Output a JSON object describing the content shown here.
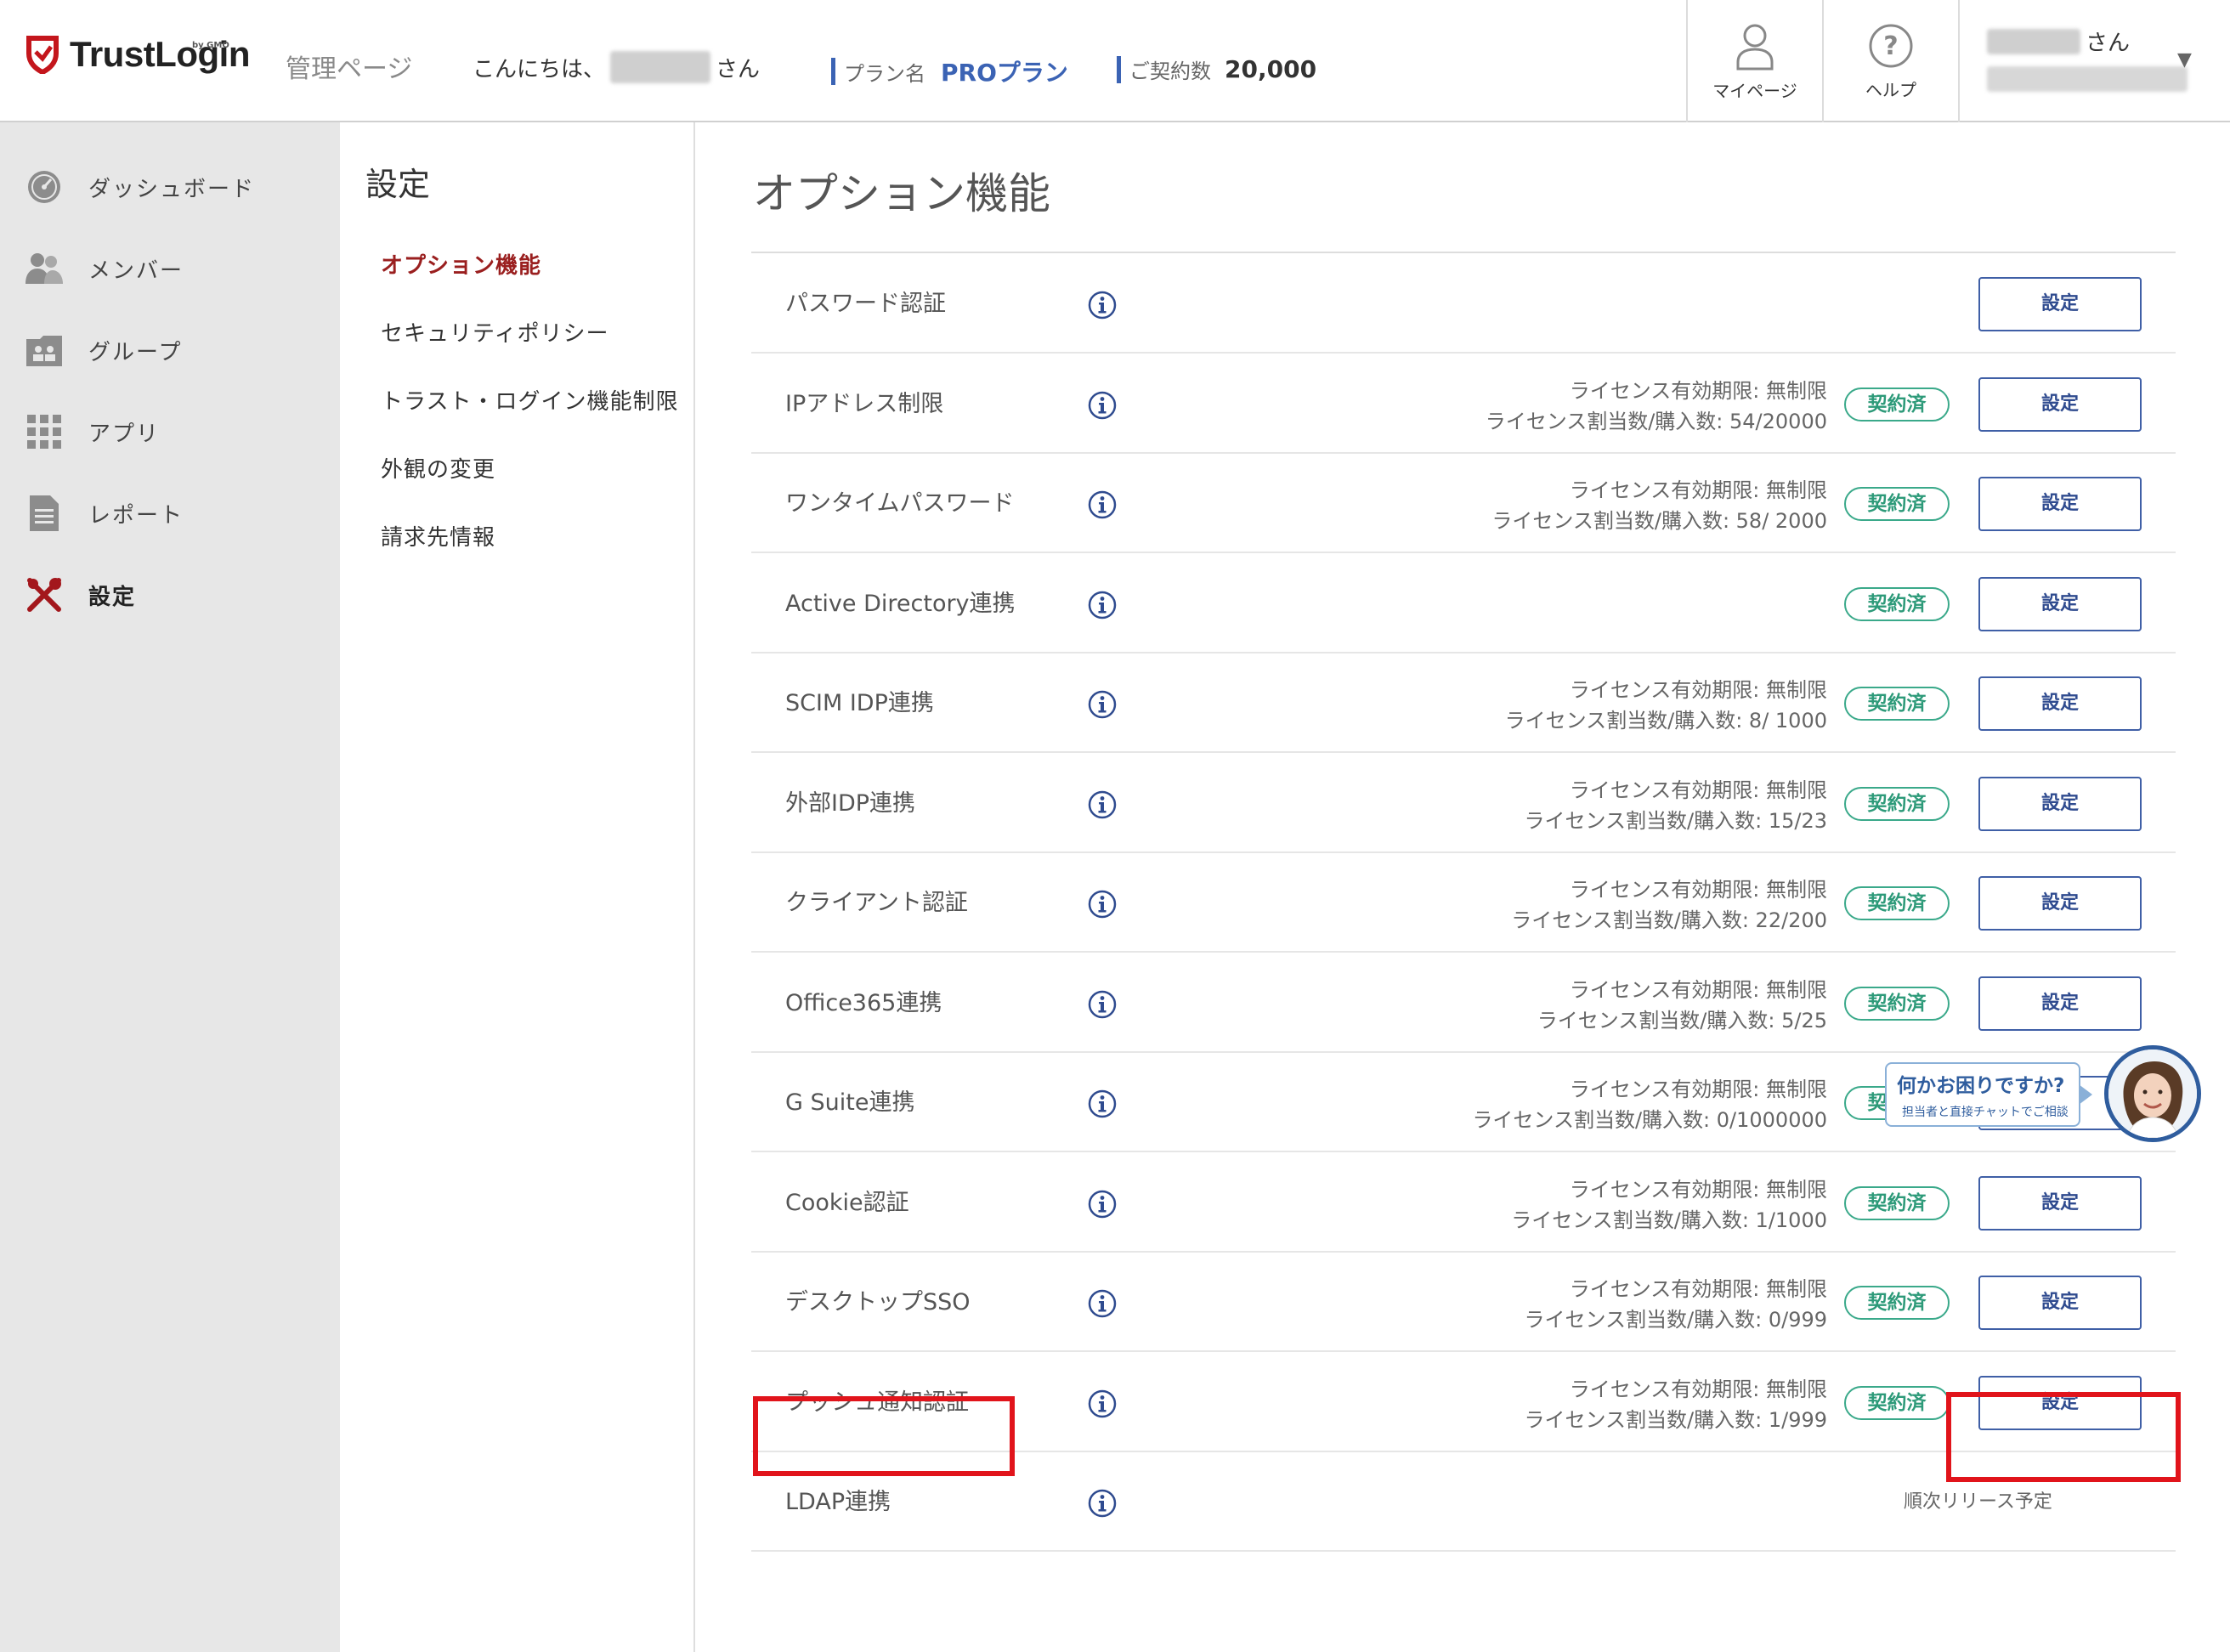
{
  "header": {
    "logo_text": "TrustLogin",
    "logo_sub": "by GMO",
    "admin_label": "管理ページ",
    "greeting_prefix": "こんにちは、",
    "greeting_suffix": "さん",
    "plan_label": "プラン名",
    "plan_value": "PROプラン",
    "contract_label": "ご契約数",
    "contract_value": "20,000",
    "mypage_label": "マイページ",
    "help_label": "ヘルプ",
    "user_suffix": "さん"
  },
  "leftnav": {
    "items": [
      {
        "label": "ダッシュボード",
        "icon": "dashboard-icon"
      },
      {
        "label": "メンバー",
        "icon": "members-icon"
      },
      {
        "label": "グループ",
        "icon": "group-icon"
      },
      {
        "label": "アプリ",
        "icon": "apps-icon"
      },
      {
        "label": "レポート",
        "icon": "report-icon"
      },
      {
        "label": "設定",
        "icon": "settings-tools-icon",
        "active": true
      }
    ]
  },
  "subnav": {
    "title": "設定",
    "items": [
      {
        "label": "オプション機能",
        "active": true
      },
      {
        "label": "セキュリティポリシー"
      },
      {
        "label": "トラスト・ログイン機能制限"
      },
      {
        "label": "外観の変更"
      },
      {
        "label": "請求先情報"
      }
    ]
  },
  "main": {
    "title": "オプション機能",
    "set_label": "設定",
    "badge_label": "契約済",
    "license_period": "ライセンス有効期限: 無制限",
    "rows": [
      {
        "name": "パスワード認証"
      },
      {
        "name": "IPアドレス制限",
        "count": "ライセンス割当数/購入数: 54/20000"
      },
      {
        "name": "ワンタイムパスワード",
        "count": "ライセンス割当数/購入数: 58/ 2000"
      },
      {
        "name": "Active Directory連携"
      },
      {
        "name": "SCIM IDP連携",
        "count": "ライセンス割当数/購入数: 8/ 1000"
      },
      {
        "name": "外部IDP連携",
        "count": "ライセンス割当数/購入数: 15/23"
      },
      {
        "name": "クライアント認証",
        "count": "ライセンス割当数/購入数: 22/200"
      },
      {
        "name": "Office365連携",
        "count": "ライセンス割当数/購入数: 5/25"
      },
      {
        "name": "G Suite連携",
        "count": "ライセンス割当数/購入数: 0/1000000"
      },
      {
        "name": "Cookie認証",
        "count": "ライセンス割当数/購入数: 1/1000"
      },
      {
        "name": "デスクトップSSO",
        "count": "ライセンス割当数/購入数: 0/999"
      },
      {
        "name": "プッシュ通知認証",
        "count": "ライセンス割当数/購入数: 1/999"
      },
      {
        "name": "LDAP連携",
        "release": "順次リリース予定"
      }
    ]
  },
  "chat": {
    "title": "何かお困りですか?",
    "subtitle": "担当者と直接チャットでご相談"
  },
  "colors": {
    "accent_blue": "#3b63b4",
    "badge_green": "#2d9a79",
    "active_red": "#9a1f1f",
    "highlight_red": "#e1141b"
  }
}
